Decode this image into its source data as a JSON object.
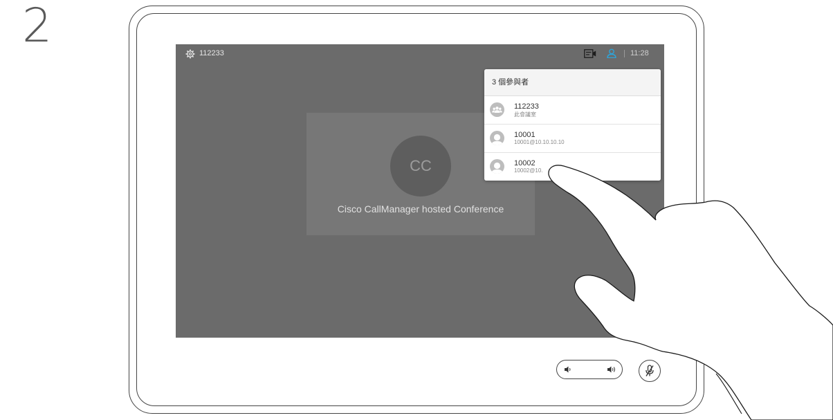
{
  "step": {
    "number": "2"
  },
  "topbar": {
    "meeting_id": "112233",
    "time": "11:28",
    "icons": [
      "settings-icon",
      "video-layout-icon",
      "participants-icon"
    ]
  },
  "conference": {
    "avatar_initials": "CC",
    "name": "Cisco CallManager hosted Conference"
  },
  "participants_popup": {
    "header": "3 個參與者",
    "items": [
      {
        "name": "112233",
        "subtitle": "此會議室",
        "icon": "group-icon"
      },
      {
        "name": "10001",
        "subtitle": "10001@10.10.10.10",
        "icon": "person-icon"
      },
      {
        "name": "10002",
        "subtitle": "10002@10.",
        "icon": "person-icon"
      }
    ]
  },
  "controls": {
    "icons": [
      "volume-down-icon",
      "volume-up-icon",
      "microphone-muted-icon"
    ]
  },
  "colors": {
    "screen_bg": "#6b6b6b",
    "accent": "#2ea4d8",
    "device_outline": "#444444"
  }
}
